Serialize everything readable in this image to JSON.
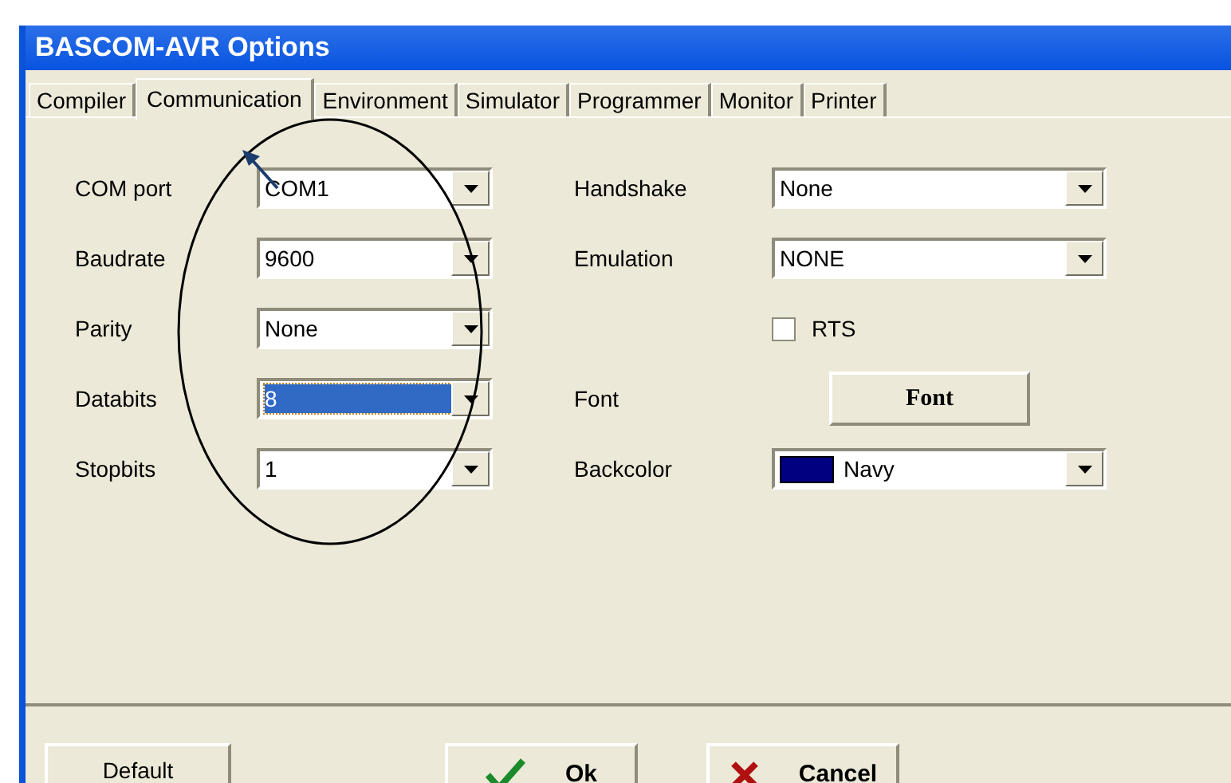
{
  "window": {
    "title": "BASCOM-AVR Options"
  },
  "tabs": [
    {
      "label": "Compiler",
      "selected": false
    },
    {
      "label": "Communication",
      "selected": true
    },
    {
      "label": "Environment",
      "selected": false
    },
    {
      "label": "Simulator",
      "selected": false
    },
    {
      "label": "Programmer",
      "selected": false
    },
    {
      "label": "Monitor",
      "selected": false
    },
    {
      "label": "Printer",
      "selected": false
    }
  ],
  "left_fields": [
    {
      "label": "COM port",
      "value": "COM1",
      "focused": false
    },
    {
      "label": "Baudrate",
      "value": "9600",
      "focused": false
    },
    {
      "label": "Parity",
      "value": "None",
      "focused": false
    },
    {
      "label": "Databits",
      "value": "8",
      "focused": true
    },
    {
      "label": "Stopbits",
      "value": "1",
      "focused": false
    }
  ],
  "right_fields": [
    {
      "kind": "combo",
      "label": "Handshake",
      "value": "None"
    },
    {
      "kind": "combo",
      "label": "Emulation",
      "value": "NONE"
    },
    {
      "kind": "checkbox",
      "label": "RTS",
      "checked": false
    },
    {
      "kind": "button",
      "label": "Font",
      "button": "Font"
    },
    {
      "kind": "color",
      "label": "Backcolor",
      "value": "Navy",
      "color": "#000080"
    }
  ],
  "buttons": [
    {
      "kind": "default",
      "label": "Default"
    },
    {
      "kind": "ok",
      "label": "Ok"
    },
    {
      "kind": "cancel",
      "label": "Cancel"
    }
  ]
}
